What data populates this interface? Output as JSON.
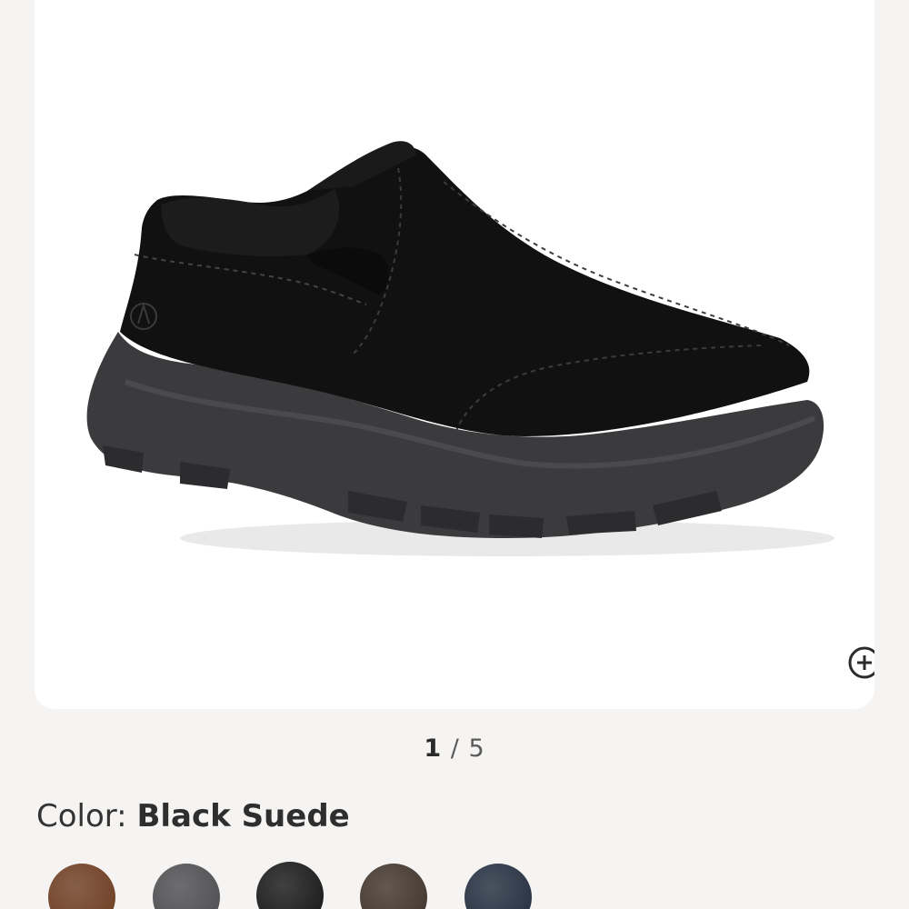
{
  "gallery": {
    "current_index": "1",
    "separator": "/",
    "total": "5",
    "zoom_icon": "zoom-in-icon"
  },
  "color": {
    "label": "Color:",
    "selected": "Black Suede",
    "swatches": [
      {
        "name": "brown",
        "color": "#6b3a1e"
      },
      {
        "name": "grey",
        "color": "#4a4b4d"
      },
      {
        "name": "black",
        "color": "#141414",
        "selected": true
      },
      {
        "name": "dark-brown",
        "color": "#3d3128"
      },
      {
        "name": "navy",
        "color": "#1f2a3b"
      }
    ]
  },
  "colors": {
    "page_background": "#f5f4f2",
    "card_background": "#ffffff"
  }
}
